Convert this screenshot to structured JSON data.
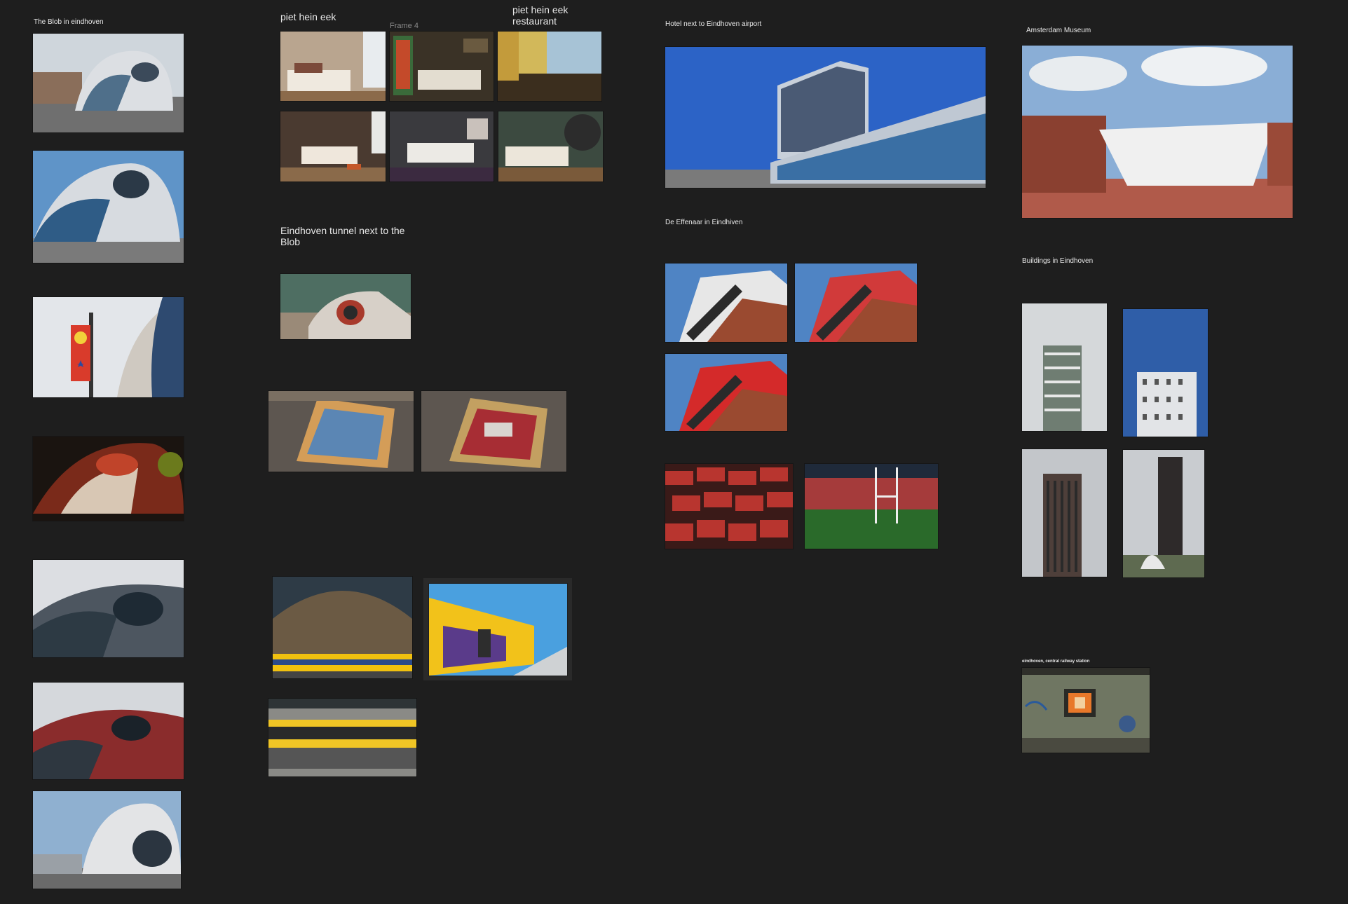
{
  "canvas": {
    "groups": {
      "blob": {
        "title": "The Blob in eindhoven"
      },
      "piet_hein_eek": {
        "title": "piet hein eek"
      },
      "frame4": {
        "title": "Frame 4"
      },
      "restaurant": {
        "title": "piet hein eek restaurant"
      },
      "tunnel": {
        "title": "Eindhoven tunnel next to the Blob"
      },
      "hotel": {
        "title": "Hotel next to Eindhoven airport"
      },
      "effenaar": {
        "title": "De Effenaar in Eindhiven"
      },
      "amsterdam": {
        "title": "Amsterdam Museum"
      },
      "buildings": {
        "title": "Buildings in Eindhoven"
      },
      "station": {
        "title": "eindhoven, central railway station"
      }
    }
  }
}
